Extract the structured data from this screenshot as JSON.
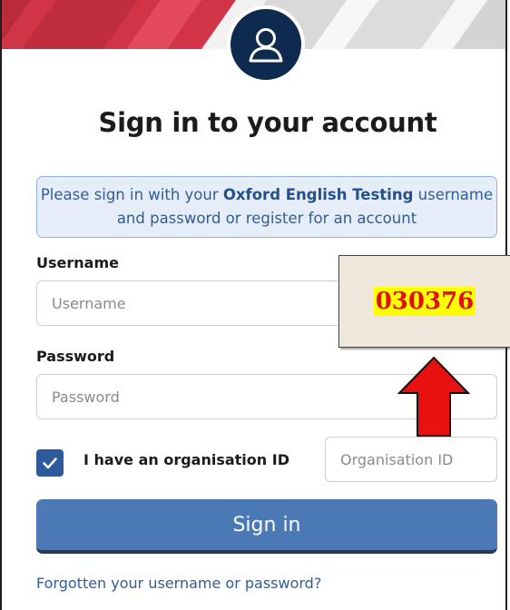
{
  "header": {
    "title": "Sign in to your account",
    "avatar_icon": "user-icon"
  },
  "notice": {
    "text_before": "Please sign in with your ",
    "brand": "Oxford English Testing",
    "text_after": " username and password or register for an account"
  },
  "form": {
    "username": {
      "label": "Username",
      "placeholder": "Username",
      "value": ""
    },
    "password": {
      "label": "Password",
      "placeholder": "Password",
      "value": ""
    },
    "organisation": {
      "checkbox_label": "I have an organisation ID",
      "checked": true,
      "placeholder": "Organisation ID"
    },
    "submit_label": "Sign in",
    "forgot_link": "Forgotten your username or password?"
  },
  "annotation": {
    "code": "030376",
    "arrow_icon": "red-up-arrow-icon"
  },
  "colors": {
    "navy": "#0e2a4f",
    "primary_button": "#4b79b5",
    "link": "#2e5d9b",
    "notice_bg": "#e5eef8",
    "banner_red": "#d23447",
    "annotation_red": "#e01010",
    "annotation_highlight": "#ffff00"
  }
}
